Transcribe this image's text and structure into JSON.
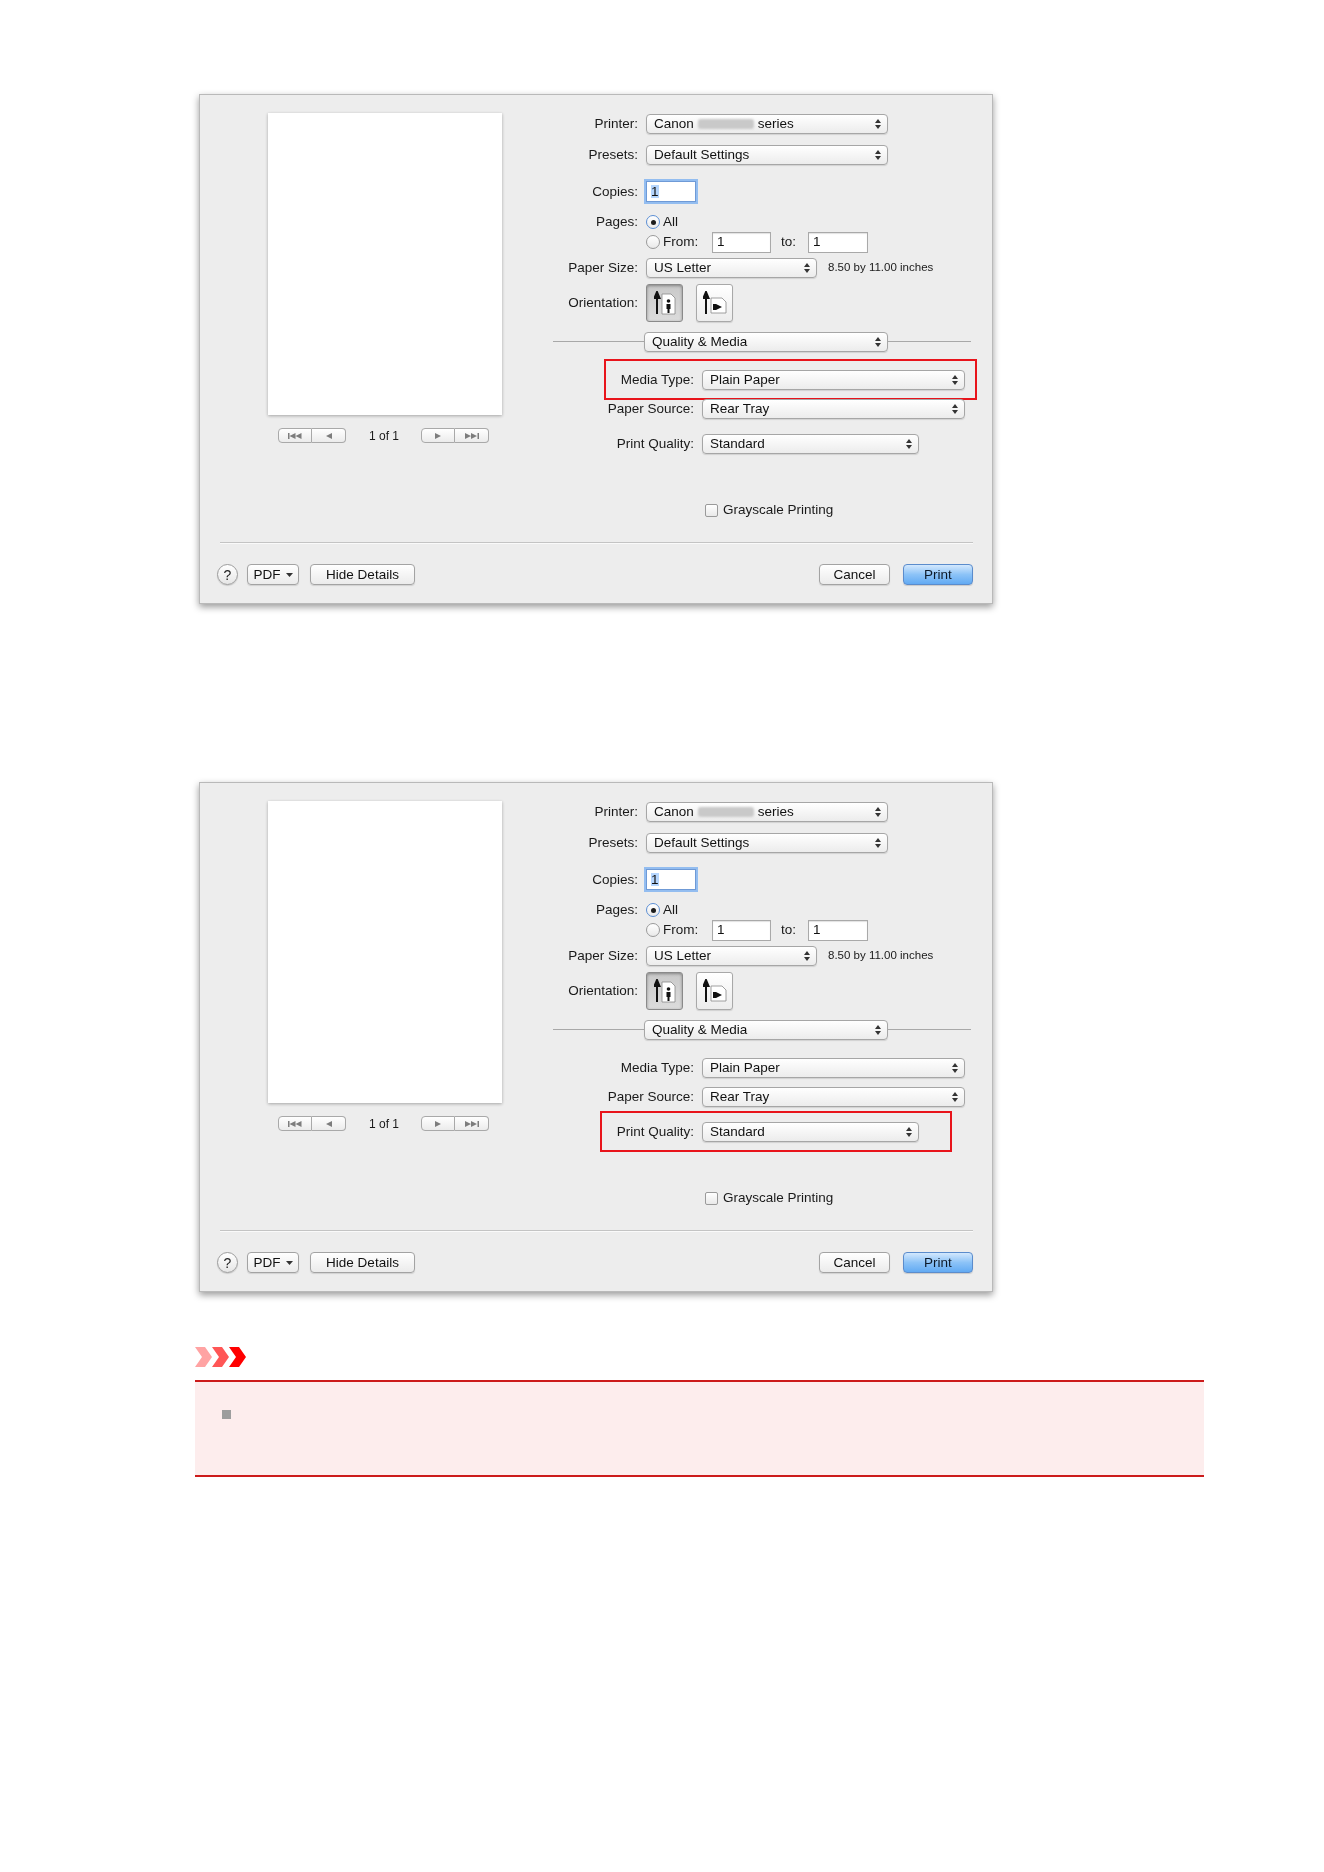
{
  "dialogs": [
    {
      "preview": {
        "page_counter": "1 of 1"
      },
      "printer": {
        "label": "Printer:",
        "value_start": "Canon",
        "redacted": true,
        "value_end": "series"
      },
      "presets": {
        "label": "Presets:",
        "value": "Default Settings"
      },
      "copies": {
        "label": "Copies:",
        "value": "1",
        "focused": true
      },
      "pages": {
        "label": "Pages:",
        "options": [
          {
            "label": "All",
            "selected": true
          },
          {
            "label": "From:",
            "selected": false
          }
        ],
        "from": "1",
        "to_label": "to:",
        "to": "1"
      },
      "paper_size": {
        "label": "Paper Size:",
        "value": "US Letter",
        "dimensions": "8.50 by 11.00 inches"
      },
      "orientation": {
        "label": "Orientation:",
        "options": [
          {
            "kind": "portrait",
            "selected": true
          },
          {
            "kind": "landscape",
            "selected": false
          }
        ]
      },
      "panel": {
        "value": "Quality & Media"
      },
      "settings": [
        {
          "label": "Media Type:",
          "value": "Plain Paper",
          "highlighted": true
        },
        {
          "label": "Paper Source:",
          "value": "Rear Tray",
          "highlighted": false
        },
        {
          "label": "Print Quality:",
          "value": "Standard",
          "highlighted": false
        }
      ],
      "grayscale": {
        "label": "Grayscale Printing",
        "checked": false
      },
      "left_buttons": [
        {
          "kind": "help",
          "label": "?"
        },
        {
          "kind": "menu",
          "label": "PDF"
        },
        {
          "kind": "push",
          "label": "Hide Details"
        }
      ],
      "right_buttons": [
        {
          "kind": "push",
          "label": "Cancel"
        },
        {
          "kind": "default",
          "label": "Print"
        }
      ]
    },
    {
      "preview": {
        "page_counter": "1 of 1"
      },
      "printer": {
        "label": "Printer:",
        "value_start": "Canon",
        "redacted": true,
        "value_end": "series"
      },
      "presets": {
        "label": "Presets:",
        "value": "Default Settings"
      },
      "copies": {
        "label": "Copies:",
        "value": "1",
        "focused": true
      },
      "pages": {
        "label": "Pages:",
        "options": [
          {
            "label": "All",
            "selected": true
          },
          {
            "label": "From:",
            "selected": false
          }
        ],
        "from": "1",
        "to_label": "to:",
        "to": "1"
      },
      "paper_size": {
        "label": "Paper Size:",
        "value": "US Letter",
        "dimensions": "8.50 by 11.00 inches"
      },
      "orientation": {
        "label": "Orientation:",
        "options": [
          {
            "kind": "portrait",
            "selected": true
          },
          {
            "kind": "landscape",
            "selected": false
          }
        ]
      },
      "panel": {
        "value": "Quality & Media"
      },
      "settings": [
        {
          "label": "Media Type:",
          "value": "Plain Paper",
          "highlighted": false
        },
        {
          "label": "Paper Source:",
          "value": "Rear Tray",
          "highlighted": false
        },
        {
          "label": "Print Quality:",
          "value": "Standard",
          "highlighted": true
        }
      ],
      "grayscale": {
        "label": "Grayscale Printing",
        "checked": false
      },
      "left_buttons": [
        {
          "kind": "help",
          "label": "?"
        },
        {
          "kind": "menu",
          "label": "PDF"
        },
        {
          "kind": "push",
          "label": "Hide Details"
        }
      ],
      "right_buttons": [
        {
          "kind": "push",
          "label": "Cancel"
        },
        {
          "kind": "default",
          "label": "Print"
        }
      ]
    }
  ],
  "note": {
    "kind": "important"
  }
}
